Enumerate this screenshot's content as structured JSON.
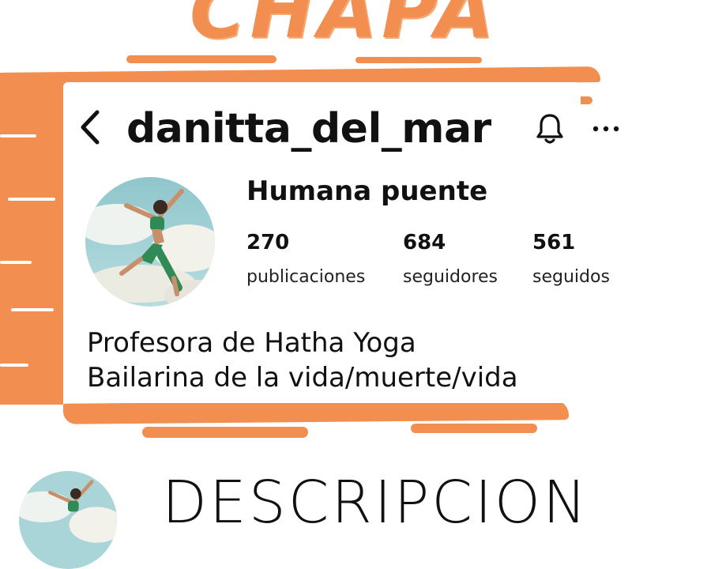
{
  "banner": {
    "headline": "CHAPA"
  },
  "profile": {
    "username": "danitta_del_mar",
    "display_name": "Humana puente",
    "stats": [
      {
        "count": "270",
        "label": "publicaciones"
      },
      {
        "count": "684",
        "label": "seguidores"
      },
      {
        "count": "561",
        "label": "seguidos"
      }
    ],
    "bio_lines": [
      "Profesora de Hatha Yoga",
      "Bailarina de la vida/muerte/vida"
    ]
  },
  "icons": {
    "back": "chevron-left-icon",
    "notifications": "bell-icon",
    "more": "more-horizontal-icon"
  },
  "section": {
    "title": "DESCRIPCION"
  },
  "colors": {
    "accent": "#f28f50",
    "text": "#111111",
    "background": "#ffffff"
  }
}
